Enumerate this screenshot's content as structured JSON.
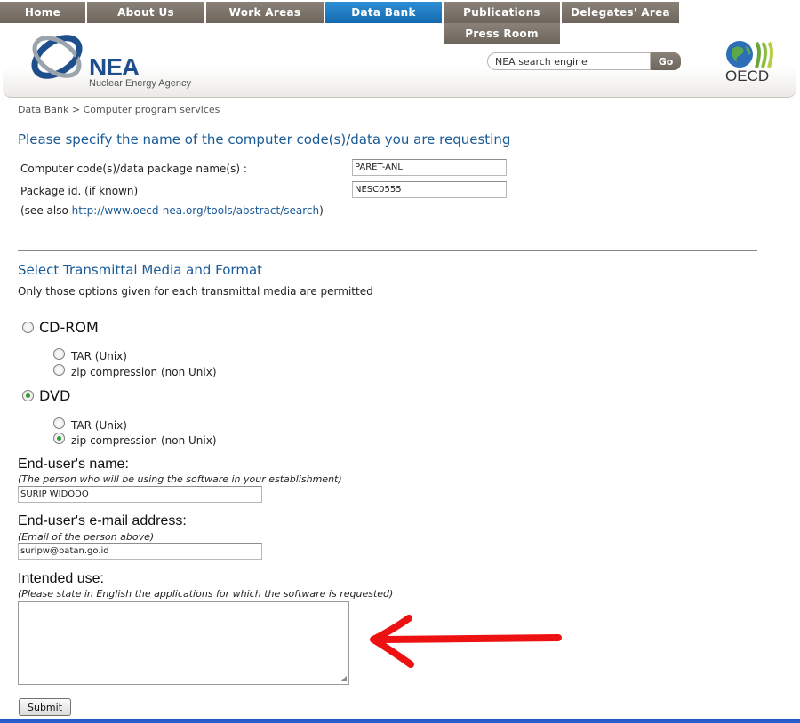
{
  "nav": {
    "tabs": [
      {
        "label": "Home"
      },
      {
        "label": "About Us"
      },
      {
        "label": "Work Areas"
      },
      {
        "label": "Data Bank"
      },
      {
        "label": "Publications"
      },
      {
        "label": "Delegates' Area"
      }
    ],
    "sub_tab": "Press Room",
    "active": "Data Bank"
  },
  "header": {
    "logo_text": "NEA",
    "logo_subtext": "Nuclear Energy Agency",
    "search_placeholder": "NEA search engine",
    "search_button": "Go",
    "oecd_text": "OECD"
  },
  "breadcrumb": "Data Bank > Computer program services",
  "section1": {
    "title": "Please specify the name of the computer code(s)/data you are requesting",
    "code_label": "Computer code(s)/data package name(s) :",
    "code_value": "PARET-ANL",
    "package_label": "Package id. (if known)",
    "package_value": "NESC0555",
    "see_also_prefix": "(see also ",
    "see_also_link": "http://www.oecd-nea.org/tools/abstract/search",
    "see_also_suffix": ")"
  },
  "section2": {
    "title": "Select Transmittal Media and Format",
    "subtitle": "Only those options given for each transmittal media are permitted",
    "media": [
      {
        "label": "CD-ROM",
        "checked": false,
        "options": [
          {
            "label": "TAR (Unix)",
            "checked": false
          },
          {
            "label": "zip compression (non Unix)",
            "checked": false
          }
        ]
      },
      {
        "label": "DVD",
        "checked": true,
        "options": [
          {
            "label": "TAR (Unix)",
            "checked": false
          },
          {
            "label": "zip compression (non Unix)",
            "checked": true
          }
        ]
      }
    ]
  },
  "enduser": {
    "name_title": "End-user's name:",
    "name_hint": "(The person who will be using the software in your establishment)",
    "name_value": "SURIP WIDODO",
    "email_title": "End-user's e-mail address:",
    "email_hint": "(Email of the person above)",
    "email_value": "suripw@batan.go.id",
    "use_title": "Intended use:",
    "use_hint": "(Please state in English the applications for which the software is requested)",
    "use_value": ""
  },
  "submit_label": "Submit",
  "colors": {
    "nav": "#7c746a",
    "active": "#1f7fc8",
    "heading": "#1a5a96",
    "arrow": "#ee1111"
  }
}
